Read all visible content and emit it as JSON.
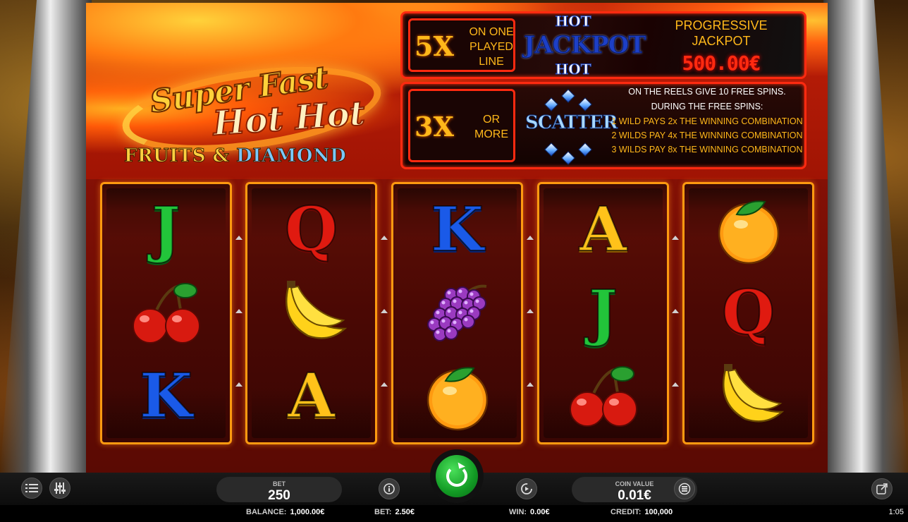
{
  "logo": {
    "line1": "Super Fast",
    "line2": "Hot Hot",
    "fruits": "FRUITS",
    "amp": "&",
    "diamond": "DIAMOND"
  },
  "jackpot_panel": {
    "multiplier": "5X",
    "condition": "ON ONE PLAYED LINE",
    "logo_top": "HOT",
    "logo_main": "JACKPOT",
    "logo_bottom": "HOT",
    "title": "PROGRESSIVE JACKPOT",
    "value": "500.00€"
  },
  "scatter_panel": {
    "multiplier": "3X",
    "condition": "OR MORE",
    "logo": "SCATTER",
    "line1": "ON THE REELS GIVE 10 FREE SPINS.",
    "line2": "DURING THE FREE SPINS:",
    "wild_lines": [
      "1 WILD PAYS 2x THE WINNING COMBINATION",
      "2 WILDS PAY 4x THE WINNING COMBINATION",
      "3 WILDS PAY 8x THE WINNING COMBINATION"
    ]
  },
  "reels": [
    [
      "J",
      "cherry",
      "K"
    ],
    [
      "Q",
      "banana",
      "A"
    ],
    [
      "K",
      "grapes",
      "orange"
    ],
    [
      "A",
      "J",
      "cherry"
    ],
    [
      "orange",
      "Q",
      "banana"
    ]
  ],
  "controls": {
    "menu_icon": "menu-icon",
    "settings_icon": "sliders-icon",
    "bet_label": "BET",
    "bet_value": "250",
    "info_icon": "info-icon",
    "spin_icon": "spin-icon",
    "autoplay_icon": "autoplay-icon",
    "coin_value_label": "COIN VALUE",
    "coin_value": "0.01€",
    "coins_icon": "coins-icon",
    "external_icon": "external-link-icon"
  },
  "status": {
    "balance_label": "BALANCE:",
    "balance": "1,000.00€",
    "bet_label": "BET:",
    "bet": "2.50€",
    "win_label": "WIN:",
    "win": "0.00€",
    "credit_label": "CREDIT:",
    "credit": "100,000",
    "clock": "1:05"
  },
  "colors": {
    "panel_border": "#ff2a10",
    "reel_border": "#ff9a10",
    "accent_text": "#ffb81a",
    "spin_button": "#22b032"
  }
}
